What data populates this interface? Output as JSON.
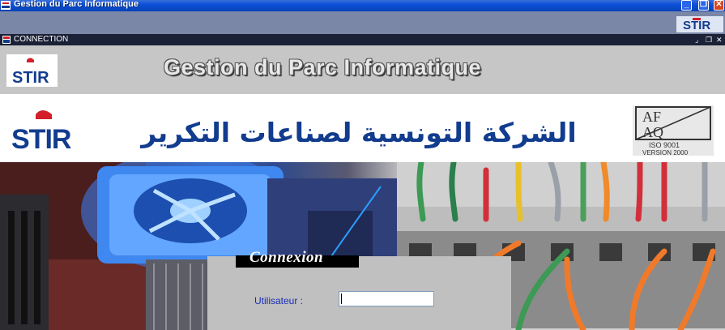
{
  "window": {
    "title": "Gestion du Parc Informatique",
    "buttons": {
      "minimize": "_",
      "restore": "❐",
      "close": "✕"
    }
  },
  "child_window": {
    "title": "CONNECTION",
    "buttons": {
      "minimize": "⌟",
      "restore": "❐",
      "close": "✕"
    }
  },
  "header": {
    "title": "Gestion du Parc Informatique",
    "logo_text": "STIR"
  },
  "banner": {
    "company_arabic": "الشركة التونسية لصناعات التكرير",
    "logo_text": "STIR",
    "cert": {
      "line1": "AF",
      "line2": "AQ",
      "standard": "ISO 9001",
      "version": "VERSION 2000"
    }
  },
  "login": {
    "heading": "Connexion",
    "user_label": "Utilisateur :",
    "user_value": ""
  },
  "colors": {
    "titlebar_blue": "#0a50d8",
    "menubar": "#7a87a6",
    "header_gray": "#c6c6c6",
    "stir_blue": "#123c8e",
    "stir_red": "#d21f2a",
    "label_blue": "#1a2ab8"
  }
}
